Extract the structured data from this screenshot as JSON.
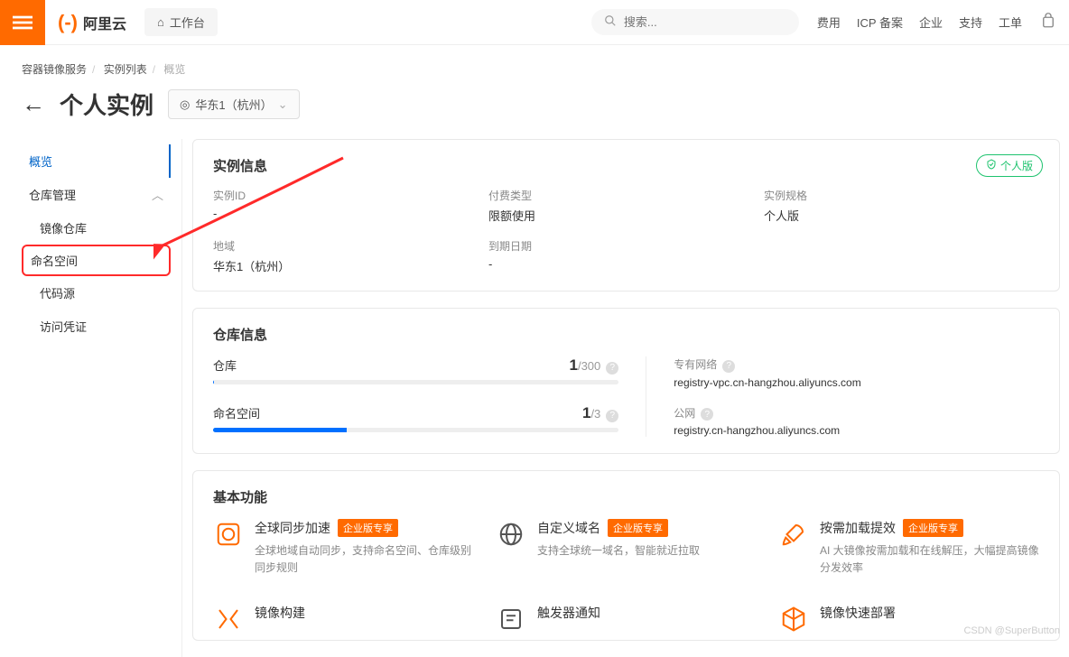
{
  "header": {
    "logo_text": "阿里云",
    "workbench": "工作台",
    "search_placeholder": "搜索...",
    "links": [
      "费用",
      "ICP 备案",
      "企业",
      "支持",
      "工单"
    ]
  },
  "breadcrumb": {
    "items": [
      "容器镜像服务",
      "实例列表",
      "概览"
    ]
  },
  "title": "个人实例",
  "region": "华东1（杭州）",
  "sidebar": {
    "overview": "概览",
    "group": "仓库管理",
    "items": [
      "镜像仓库",
      "命名空间",
      "代码源",
      "访问凭证"
    ]
  },
  "instance_card": {
    "title": "实例信息",
    "badge": "个人版",
    "fields": [
      {
        "label": "实例ID",
        "value": "-"
      },
      {
        "label": "付费类型",
        "value": "限额使用"
      },
      {
        "label": "实例规格",
        "value": "个人版"
      },
      {
        "label": "地域",
        "value": "华东1（杭州）"
      },
      {
        "label": "到期日期",
        "value": "-"
      }
    ]
  },
  "repo_card": {
    "title": "仓库信息",
    "quotas": [
      {
        "label": "仓库",
        "num": "1",
        "den": "/300",
        "pct": 0.3
      },
      {
        "label": "命名空间",
        "num": "1",
        "den": "/3",
        "pct": 33
      }
    ],
    "networks": [
      {
        "label": "专有网络",
        "value": "registry-vpc.cn-hangzhou.aliyuncs.com"
      },
      {
        "label": "公网",
        "value": "registry.cn-hangzhou.aliyuncs.com"
      }
    ]
  },
  "features": {
    "title": "基本功能",
    "enterprise_tag": "企业版专享",
    "items": [
      {
        "title": "全球同步加速",
        "ent": true,
        "desc": "全球地域自动同步，支持命名空间、仓库级别同步规则"
      },
      {
        "title": "自定义域名",
        "ent": true,
        "desc": "支持全球统一域名，智能就近拉取"
      },
      {
        "title": "按需加载提效",
        "ent": true,
        "desc": "AI 大镜像按需加载和在线解压，大幅提高镜像分发效率"
      },
      {
        "title": "镜像构建",
        "ent": false,
        "desc": ""
      },
      {
        "title": "触发器通知",
        "ent": false,
        "desc": ""
      },
      {
        "title": "镜像快速部署",
        "ent": false,
        "desc": ""
      }
    ]
  },
  "watermark": "CSDN @SuperButton"
}
